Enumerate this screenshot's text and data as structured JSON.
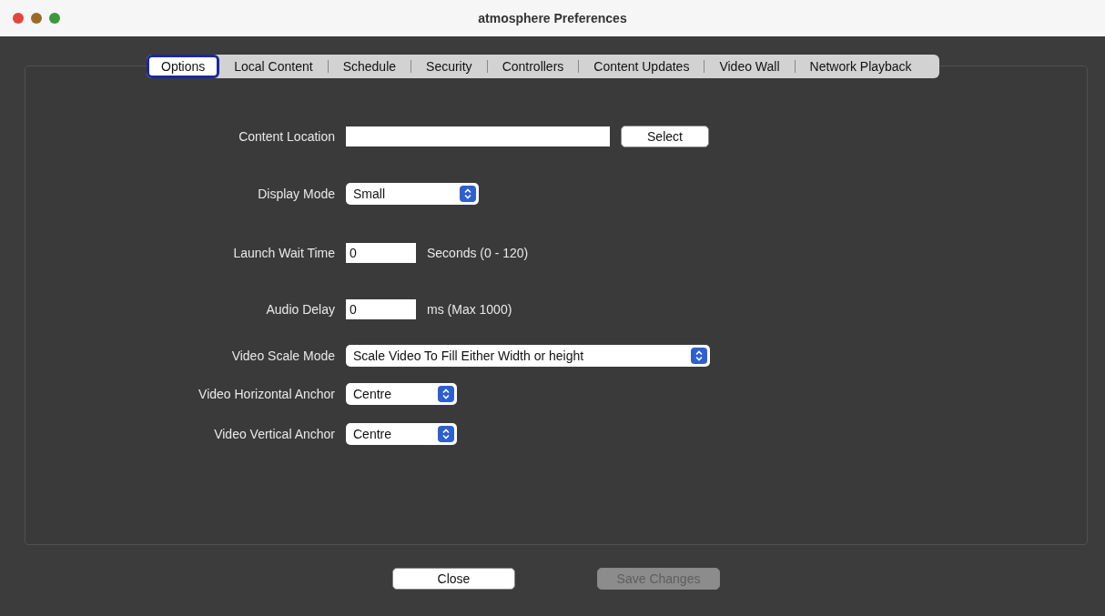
{
  "window": {
    "title": "atmosphere Preferences"
  },
  "tabs": [
    {
      "label": "Options",
      "selected": true
    },
    {
      "label": "Local Content",
      "selected": false
    },
    {
      "label": "Schedule",
      "selected": false
    },
    {
      "label": "Security",
      "selected": false
    },
    {
      "label": "Controllers",
      "selected": false
    },
    {
      "label": "Content Updates",
      "selected": false
    },
    {
      "label": "Video Wall",
      "selected": false
    },
    {
      "label": "Network Playback",
      "selected": false
    }
  ],
  "fields": [
    {
      "kind": "path",
      "label": "Content Location",
      "button": "Select"
    },
    {
      "kind": "select",
      "label": "Display Mode",
      "value": "Small"
    },
    {
      "kind": "number",
      "label": "Launch Wait Time",
      "value": "0",
      "unit": "Seconds (0 - 120)"
    },
    {
      "kind": "number",
      "label": "Audio Delay",
      "value": "0",
      "unit": "ms (Max 1000)"
    },
    {
      "kind": "select",
      "label": "Video Scale Mode",
      "value": "Scale Video To Fill Either Width or height"
    },
    {
      "kind": "select",
      "label": "Video Horizontal Anchor",
      "value": "Centre"
    },
    {
      "kind": "select",
      "label": "Video Vertical Anchor",
      "value": "Centre"
    }
  ],
  "buttons": [
    {
      "label": "Close",
      "disabled": false
    },
    {
      "label": "Save Changes",
      "disabled": true
    }
  ]
}
